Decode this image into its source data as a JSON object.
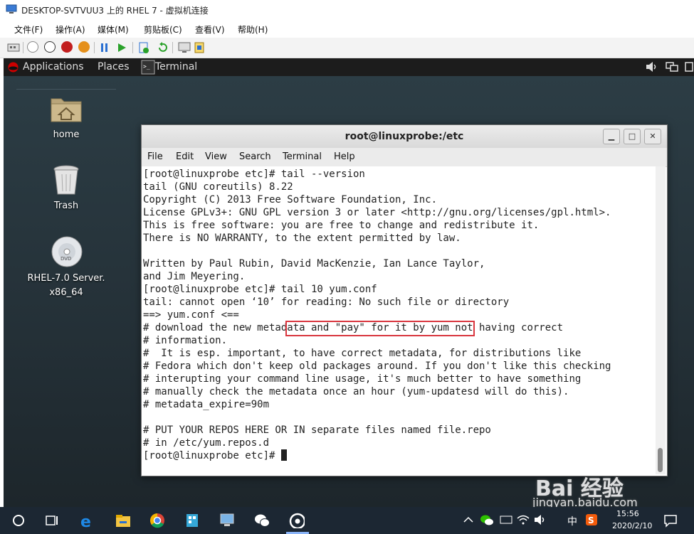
{
  "host_window": {
    "title": "DESKTOP-SVTVUU3 上的 RHEL 7 - 虚拟机连接",
    "menu": [
      "文件(F)",
      "操作(A)",
      "媒体(M)",
      "剪贴板(C)",
      "查看(V)",
      "帮助(H)"
    ]
  },
  "gnome_bar": {
    "applications": "Applications",
    "places": "Places",
    "terminal": "Terminal"
  },
  "desktop_icons": [
    {
      "label": "home"
    },
    {
      "label": "Trash"
    },
    {
      "label": "RHEL-7.0 Server.\nx86_64"
    }
  ],
  "terminal": {
    "title": "root@linuxprobe:/etc",
    "menu": [
      "File",
      "Edit",
      "View",
      "Search",
      "Terminal",
      "Help"
    ],
    "lines": [
      "[root@linuxprobe etc]# tail --version",
      "tail (GNU coreutils) 8.22",
      "Copyright (C) 2013 Free Software Foundation, Inc.",
      "License GPLv3+: GNU GPL version 3 or later <http://gnu.org/licenses/gpl.html>.",
      "This is free software: you are free to change and redistribute it.",
      "There is NO WARRANTY, to the extent permitted by law.",
      "",
      "Written by Paul Rubin, David MacKenzie, Ian Lance Taylor,",
      "and Jim Meyering.",
      "[root@linuxprobe etc]# tail 10 yum.conf",
      "tail: cannot open ‘10’ for reading: No such file or directory",
      "==> yum.conf <==",
      "# download the new metadata and \"pay\" for it by yum not having correct",
      "# information.",
      "#  It is esp. important, to have correct metadata, for distributions like",
      "# Fedora which don't keep old packages around. If you don't like this checking",
      "# interupting your command line usage, it's much better to have something",
      "# manually check the metadata once an hour (yum-updatesd will do this).",
      "# metadata_expire=90m",
      "",
      "# PUT YOUR REPOS HERE OR IN separate files named file.repo",
      "# in /etc/yum.repos.d"
    ],
    "prompt": "[root@linuxprobe etc]# "
  },
  "taskbar": {
    "ime": "中",
    "time": "15:56",
    "date": "2020/2/10"
  },
  "watermark": {
    "logo": "Bai 经验",
    "url": "jingyan.baidu.com"
  },
  "colors": {
    "highlight": "#d9363e",
    "desktop": "#2c3d45",
    "taskbar": "#1c2733"
  }
}
